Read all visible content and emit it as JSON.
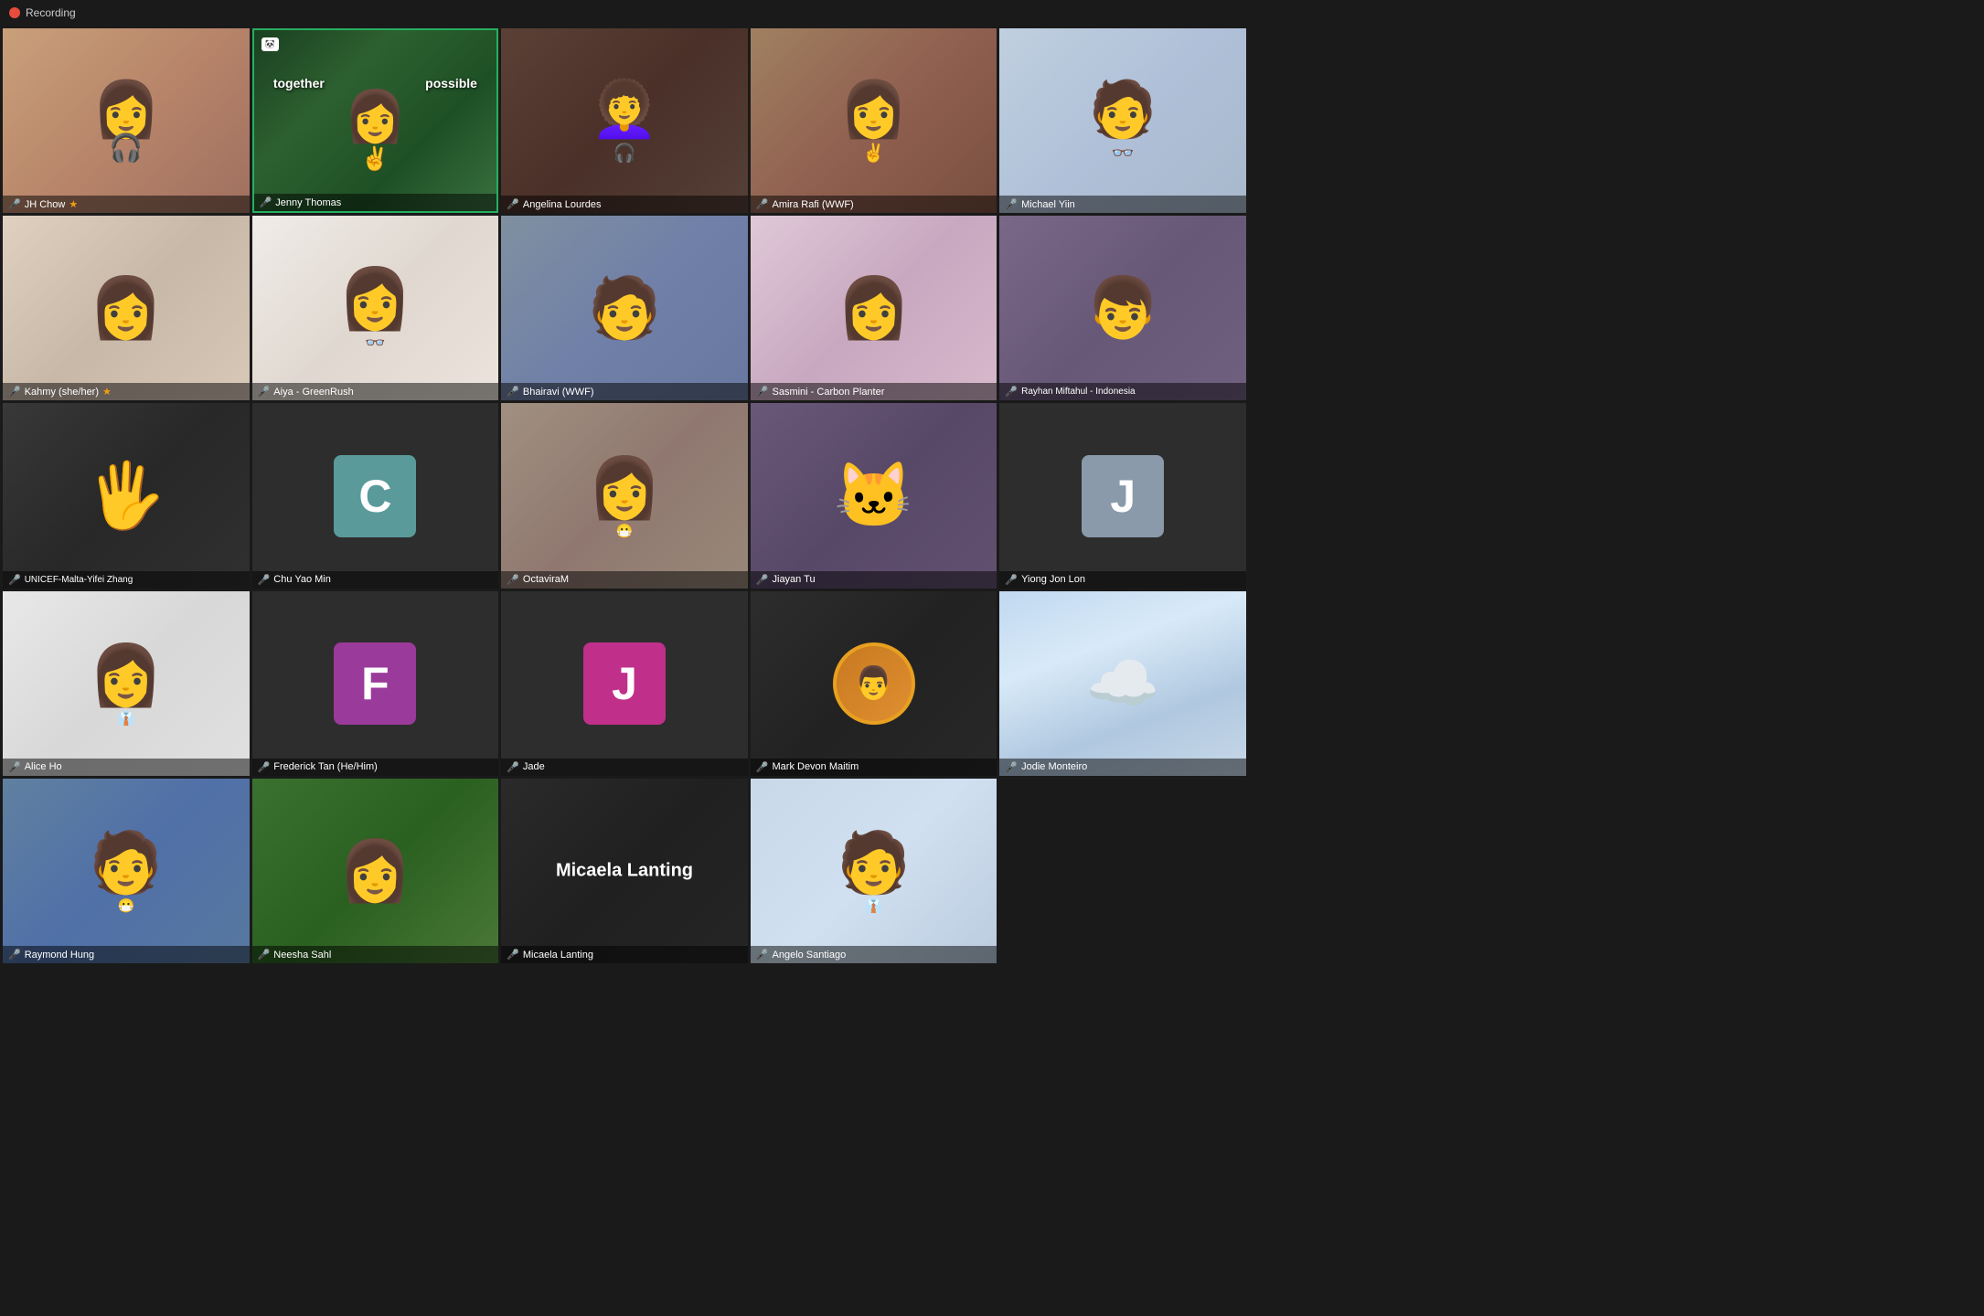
{
  "app": {
    "title": "Recording",
    "record_label": "Recording"
  },
  "participants": [
    {
      "id": "jh-chow",
      "name": "JH Chow",
      "mic": "off",
      "bg": "warm",
      "emoji": "😊",
      "row": 1,
      "col": 1,
      "type": "video"
    },
    {
      "id": "jenny-thomas",
      "name": "Jenny Thomas",
      "mic": "off",
      "bg": "green",
      "row": 1,
      "col": 2,
      "type": "video-active",
      "overlay_text_1": "together",
      "overlay_text_2": "possible"
    },
    {
      "id": "angelina-lourdes",
      "name": "Angelina Lourdes",
      "mic": "off",
      "bg": "dark-warm",
      "row": 1,
      "col": 3,
      "type": "video"
    },
    {
      "id": "amira-rafi",
      "name": "Amira Rafi (WWF)",
      "mic": "off",
      "bg": "brown-room",
      "row": 1,
      "col": 4,
      "type": "video"
    },
    {
      "id": "michael-yiin",
      "name": "Michael Yiin",
      "mic": "off",
      "bg": "office",
      "row": 1,
      "col": 5,
      "type": "video"
    },
    {
      "id": "kahmy",
      "name": "Kahmy (she/her)",
      "mic": "off",
      "bg": "light-room",
      "row": 2,
      "col": 1,
      "type": "video"
    },
    {
      "id": "aiya",
      "name": "Aiya - GreenRush",
      "mic": "off",
      "bg": "white-room",
      "row": 2,
      "col": 2,
      "type": "video"
    },
    {
      "id": "bhairavi",
      "name": "Bhairavi (WWF)",
      "mic": "off",
      "bg": "teal-room",
      "row": 2,
      "col": 3,
      "type": "video"
    },
    {
      "id": "sasmini",
      "name": "Sasmini - Carbon Planter",
      "mic": "off",
      "bg": "pink-light",
      "row": 2,
      "col": 4,
      "type": "video"
    },
    {
      "id": "rayhan",
      "name": "Rayhan Miftahul - Indonesia",
      "mic": "off",
      "bg": "purple-room",
      "row": 2,
      "col": 5,
      "type": "video"
    },
    {
      "id": "unicef-yifei",
      "name": "UNICEF-Malta-Yifei Zhang",
      "mic": "off",
      "bg": "dark",
      "row": 3,
      "col": 1,
      "type": "hand"
    },
    {
      "id": "chu-yao-min",
      "name": "Chu Yao Min",
      "mic": "off",
      "bg": "letter",
      "letter": "C",
      "letter_bg": "teal",
      "row": 3,
      "col": 2,
      "type": "letter"
    },
    {
      "id": "octaviram",
      "name": "OctaviraM",
      "mic": "off",
      "bg": "photo-room",
      "row": 3,
      "col": 3,
      "type": "photo"
    },
    {
      "id": "jiayan-tu",
      "name": "Jiayan Tu",
      "mic": "off",
      "bg": "purple-grey",
      "row": 3,
      "col": 4,
      "type": "emoji-face"
    },
    {
      "id": "yiong-jon-lon",
      "name": "Yiong Jon Lon",
      "mic": "off",
      "bg": "grey",
      "letter": "J",
      "letter_bg": "grey",
      "row": 3,
      "col": 5,
      "type": "letter"
    },
    {
      "id": "alice-ho",
      "name": "Alice Ho",
      "mic": "off",
      "bg": "white-room",
      "row": 4,
      "col": 1,
      "type": "video"
    },
    {
      "id": "frederick-tan",
      "name": "Frederick Tan (He/Him)",
      "mic": "off",
      "bg": "letter",
      "letter": "F",
      "letter_bg": "purple",
      "row": 4,
      "col": 2,
      "type": "letter"
    },
    {
      "id": "jade",
      "name": "Jade",
      "mic": "off",
      "bg": "letter",
      "letter": "J",
      "letter_bg": "magenta",
      "row": 4,
      "col": 3,
      "type": "letter"
    },
    {
      "id": "mark-devon",
      "name": "Mark Devon Maitim",
      "mic": "off",
      "bg": "orange-circle",
      "row": 4,
      "col": 4,
      "type": "photo"
    },
    {
      "id": "jodie-monteiro",
      "name": "Jodie Monteiro",
      "mic": "off",
      "bg": "sky",
      "row": 4,
      "col": 5,
      "type": "video"
    },
    {
      "id": "raymond-hung",
      "name": "Raymond Hung",
      "mic": "off",
      "bg": "blue-room",
      "row": 5,
      "col": 1,
      "type": "video"
    },
    {
      "id": "neesha-sahl",
      "name": "Neesha Sahl",
      "mic": "off",
      "bg": "green-room",
      "row": 5,
      "col": 2,
      "type": "video"
    },
    {
      "id": "micaela-lanting",
      "name": "Micaela Lanting",
      "mic": "off",
      "bg": "dark-neutral",
      "row": 5,
      "col": 3,
      "type": "name-only",
      "display_name": "Micaela Lanting"
    },
    {
      "id": "angelo-santiago",
      "name": "Angelo Santiago",
      "mic": "off",
      "bg": "light-blue",
      "row": 5,
      "col": 4,
      "type": "video"
    }
  ]
}
